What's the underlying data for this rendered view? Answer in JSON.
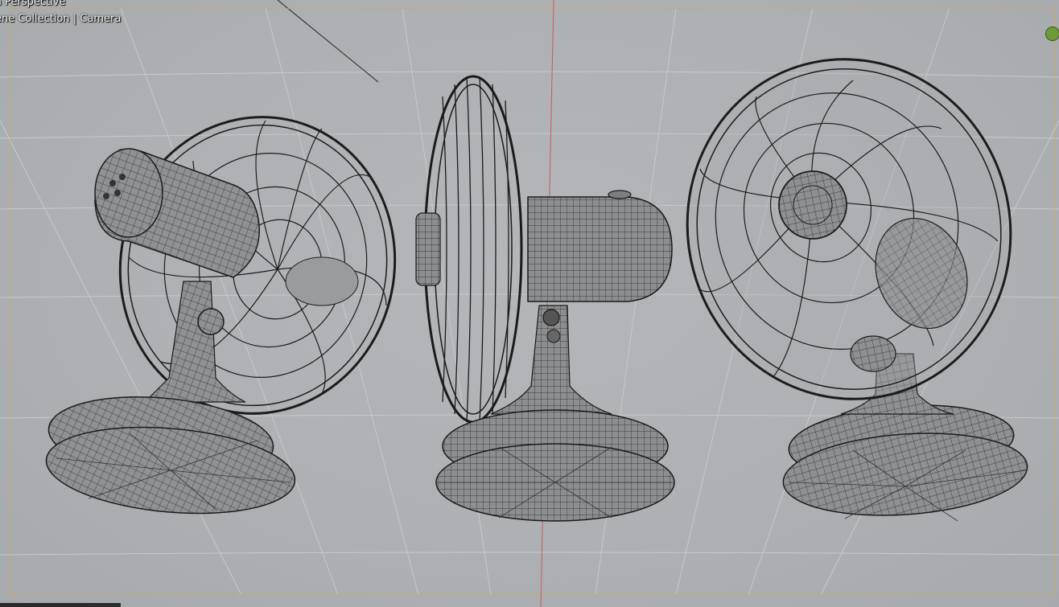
{
  "viewport": {
    "view_mode": "a Perspective",
    "collection_camera": "ene Collection | Camera"
  },
  "objects": [
    {
      "name": "table-fan",
      "view": "rear-three-quarter"
    },
    {
      "name": "table-fan",
      "view": "side"
    },
    {
      "name": "table-fan",
      "view": "front-three-quarter"
    }
  ],
  "colors": {
    "background": "#aeb1b4",
    "grid": "#c4c6c8",
    "wire": "#1c1c1c",
    "mesh_fill": "#8e9092",
    "camera_frame": "#d9a93e",
    "axis_line": "#c75b5b",
    "gizmo": "#6e9a3a"
  }
}
